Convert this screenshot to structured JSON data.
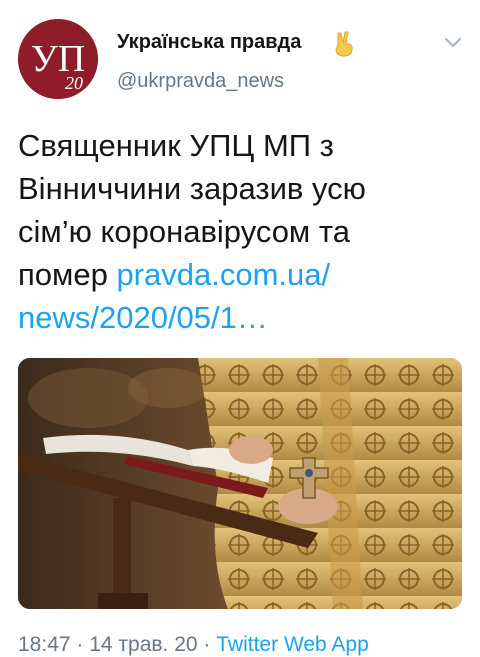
{
  "author": {
    "name": "Українська правда",
    "handle": "@ukrpravda_news",
    "avatar_text": "УП",
    "avatar_badge": "20",
    "verified_emoji_icon": "victory-hand-icon"
  },
  "tweet": {
    "text_lines": [
      "Священник УПЦ МП з",
      "Вінниччини заразив усю",
      "сім’ю коронавірусом та",
      "помер "
    ],
    "link_line1": "pravda.com.ua/",
    "link_line2": "news/2020/05/1…"
  },
  "media": {
    "description_icon": "priest-with-cross-photo"
  },
  "meta": {
    "time": "18:47",
    "separator": " · ",
    "date": "14 трав. 20",
    "app": "Twitter Web App"
  },
  "colors": {
    "link": "#1da1f2",
    "secondary_text": "#657786",
    "avatar_bg": "#8f1c2a"
  }
}
